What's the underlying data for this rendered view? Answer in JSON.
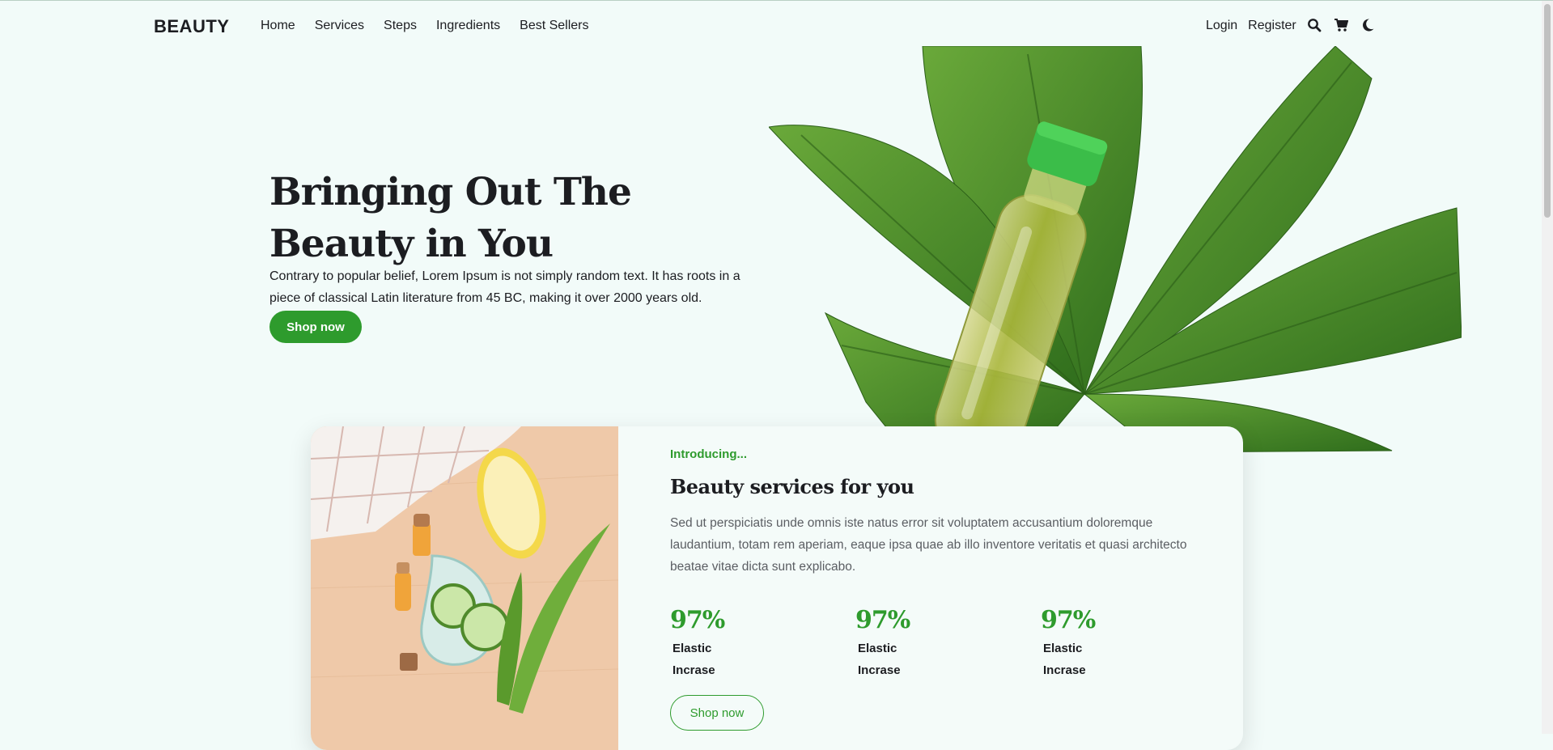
{
  "nav": {
    "brand": "BEAUTY",
    "links": [
      "Home",
      "Services",
      "Steps",
      "Ingredients",
      "Best Sellers"
    ],
    "login": "Login",
    "register": "Register",
    "icons": [
      "search-icon",
      "cart-icon",
      "moon-icon"
    ]
  },
  "hero": {
    "title": "Bringing Out The Beauty in You",
    "text": "Contrary to popular belief, Lorem Ipsum is not simply random text. It has roots in a piece of classical Latin literature from 45 BC, making it over 2000 years old.",
    "button": "Shop now"
  },
  "services": {
    "intro": "Introducing...",
    "title": "Beauty services for you",
    "text": "Sed ut perspiciatis unde omnis iste natus error sit voluptatem accusantium doloremque laudantium, totam rem aperiam, eaque ipsa quae ab illo inventore veritatis et quasi architecto beatae vitae dicta sunt explicabo.",
    "stats": [
      {
        "value": "97%",
        "label": "Elastic Incrase"
      },
      {
        "value": "97%",
        "label": "Elastic Incrase"
      },
      {
        "value": "97%",
        "label": "Elastic Incrase"
      }
    ],
    "button": "Shop now"
  },
  "colors": {
    "accent": "#2e9b2d",
    "background": "#f2fbf9"
  }
}
